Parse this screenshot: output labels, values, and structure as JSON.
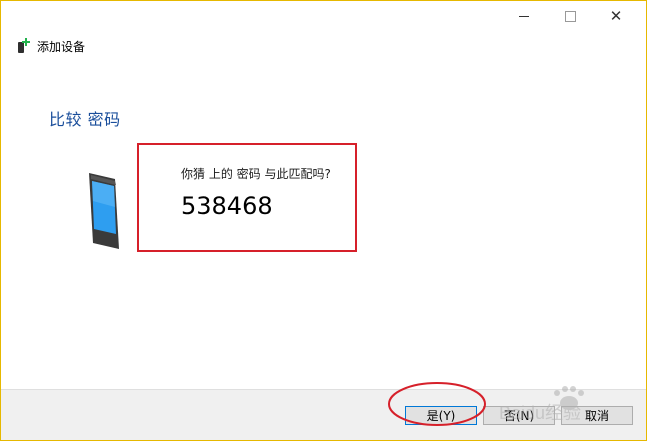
{
  "window": {
    "title": "添加设备",
    "heading": "比较 密码"
  },
  "pairing": {
    "question": "你猜 上的 密码 与此匹配吗?",
    "code": "538468"
  },
  "buttons": {
    "yes": "是(Y)",
    "no": "否(N)",
    "cancel": "取消"
  },
  "watermark_text": "Baidu经验",
  "colors": {
    "heading": "#1a4e9b",
    "highlight": "#d6202a",
    "accent_border": "#e6b800"
  },
  "icons": {
    "device": "add-device-icon",
    "phone": "phone-icon",
    "minimize": "minimize-icon",
    "maximize": "maximize-icon",
    "close": "close-icon"
  }
}
